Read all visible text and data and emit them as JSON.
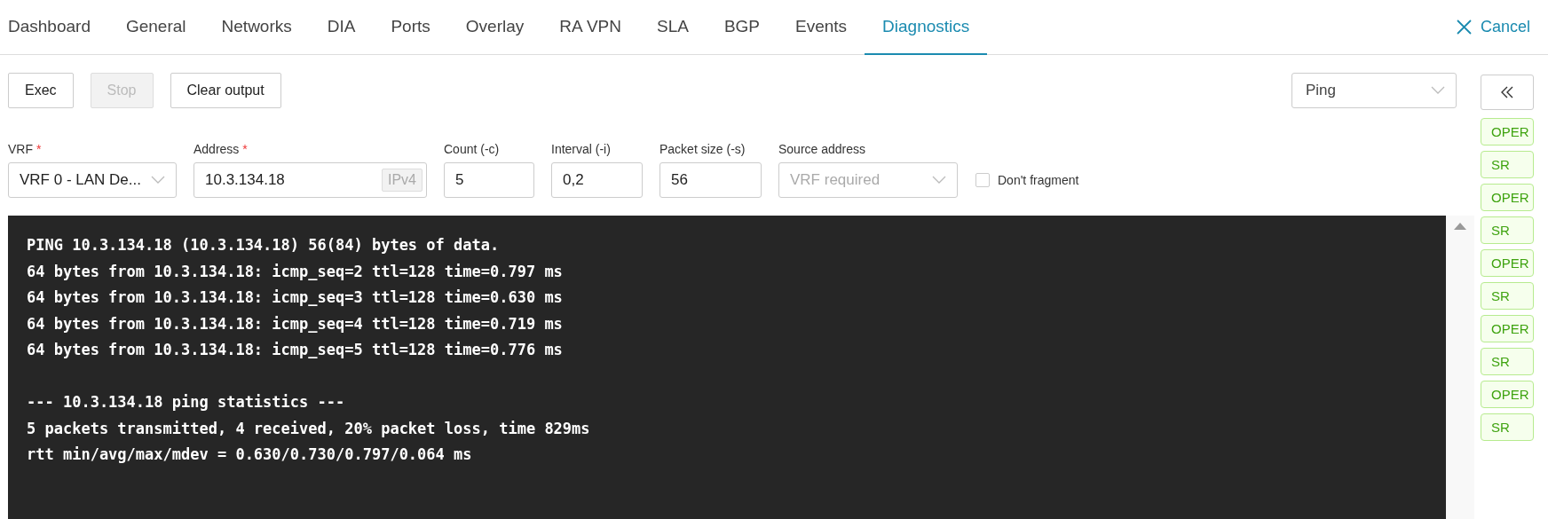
{
  "tabs": [
    {
      "label": "Dashboard",
      "selected": false
    },
    {
      "label": "General",
      "selected": false
    },
    {
      "label": "Networks",
      "selected": false
    },
    {
      "label": "DIA",
      "selected": false
    },
    {
      "label": "Ports",
      "selected": false
    },
    {
      "label": "Overlay",
      "selected": false
    },
    {
      "label": "RA VPN",
      "selected": false
    },
    {
      "label": "SLA",
      "selected": false
    },
    {
      "label": "BGP",
      "selected": false
    },
    {
      "label": "Events",
      "selected": false
    },
    {
      "label": "Diagnostics",
      "selected": true
    }
  ],
  "cancel": {
    "label": "Cancel"
  },
  "buttons": [
    {
      "label": "Exec",
      "disabled": false
    },
    {
      "label": "Stop",
      "disabled": true
    },
    {
      "label": "Clear output",
      "disabled": false
    }
  ],
  "mode_select": {
    "value": "Ping"
  },
  "fields": [
    {
      "kind": "select",
      "label": "VRF",
      "required_mark": "*",
      "value": "VRF 0 - LAN De..."
    },
    {
      "kind": "input",
      "label": "Address",
      "required_mark": "*",
      "value": "10.3.134.18",
      "suffix": "IPv4"
    },
    {
      "kind": "input",
      "label": "Count (-c)",
      "value": "5"
    },
    {
      "kind": "input",
      "label": "Interval (-i)",
      "value": "0,2"
    },
    {
      "kind": "input",
      "label": "Packet size (-s)",
      "value": "56"
    },
    {
      "kind": "select",
      "label": "Source address",
      "placeholder": "VRF required"
    },
    {
      "kind": "checkbox",
      "label": "Don't fragment",
      "checked": false
    }
  ],
  "console": {
    "blocks": [
      [
        "PING 10.3.134.18 (10.3.134.18) 56(84) bytes of data.",
        "64 bytes from 10.3.134.18: icmp_seq=2 ttl=128 time=0.797 ms",
        "64 bytes from 10.3.134.18: icmp_seq=3 ttl=128 time=0.630 ms",
        "64 bytes from 10.3.134.18: icmp_seq=4 ttl=128 time=0.719 ms",
        "64 bytes from 10.3.134.18: icmp_seq=5 ttl=128 time=0.776 ms"
      ],
      [
        "--- 10.3.134.18 ping statistics ---",
        "5 packets transmitted, 4 received, 20% packet loss, time 829ms",
        "rtt min/avg/max/mdev = 0.630/0.730/0.797/0.064 ms"
      ]
    ]
  },
  "side_badges": [
    {
      "label": "OPER"
    },
    {
      "label": "SR"
    },
    {
      "label": "OPER"
    },
    {
      "label": "SR"
    },
    {
      "label": "OPER"
    },
    {
      "label": "SR"
    },
    {
      "label": "OPER"
    },
    {
      "label": "SR"
    },
    {
      "label": "OPER"
    },
    {
      "label": "SR"
    }
  ]
}
